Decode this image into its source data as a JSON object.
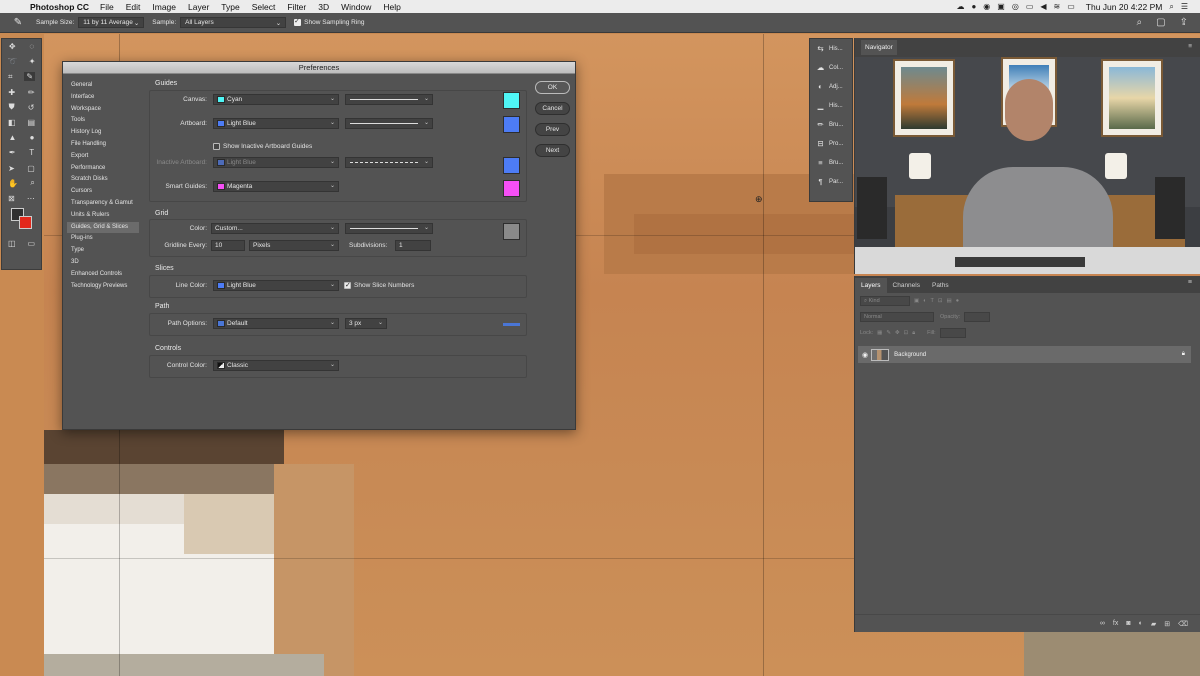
{
  "menubar": {
    "app": "Photoshop CC",
    "items": [
      "File",
      "Edit",
      "Image",
      "Layer",
      "Type",
      "Select",
      "Filter",
      "3D",
      "Window",
      "Help"
    ],
    "clock": "Thu Jun 20  4:22 PM"
  },
  "optionsbar": {
    "sample_size_label": "Sample Size:",
    "sample_size_value": "11 by 11 Average",
    "sample_label": "Sample:",
    "sample_value": "All Layers",
    "show_ring_label": "Show Sampling Ring"
  },
  "dialog": {
    "title": "Preferences",
    "nav": [
      "General",
      "Interface",
      "Workspace",
      "Tools",
      "History Log",
      "File Handling",
      "Export",
      "Performance",
      "Scratch Disks",
      "Cursors",
      "Transparency & Gamut",
      "Units & Rulers",
      "Guides, Grid & Slices",
      "Plug-ins",
      "Type",
      "3D",
      "Enhanced Controls",
      "Technology Previews"
    ],
    "active_nav": 12,
    "buttons": {
      "ok": "OK",
      "cancel": "Cancel",
      "prev": "Prev",
      "next": "Next"
    },
    "guides": {
      "title": "Guides",
      "canvas_label": "Canvas:",
      "canvas_value": "Cyan",
      "canvas_color": "#4ff5f5",
      "artboard_label": "Artboard:",
      "artboard_value": "Light Blue",
      "artboard_color": "#4d7cf5",
      "show_inactive_label": "Show Inactive Artboard Guides",
      "inactive_label": "Inactive Artboard:",
      "inactive_value": "Light Blue",
      "smart_label": "Smart Guides:",
      "smart_value": "Magenta",
      "smart_color": "#f54ff5"
    },
    "grid": {
      "title": "Grid",
      "color_label": "Color:",
      "color_value": "Custom...",
      "color_swatch": "#8a8a8a",
      "every_label": "Gridline Every:",
      "every_value": "10",
      "units_value": "Pixels",
      "subdiv_label": "Subdivisions:",
      "subdiv_value": "1"
    },
    "slices": {
      "title": "Slices",
      "line_label": "Line Color:",
      "line_value": "Light Blue",
      "numbers_label": "Show Slice Numbers"
    },
    "path": {
      "title": "Path",
      "options_label": "Path Options:",
      "options_value": "Default",
      "width_value": "3 px",
      "path_color": "#4a76d6"
    },
    "controls": {
      "title": "Controls",
      "color_label": "Control Color:",
      "color_value": "Classic"
    }
  },
  "strip": [
    "His...",
    "Col...",
    "Adj...",
    "His...",
    "Bru...",
    "Pro...",
    "Bru...",
    "Par..."
  ],
  "navigator": {
    "title": "Navigator"
  },
  "layers": {
    "tabs": [
      "Layers",
      "Channels",
      "Paths"
    ],
    "kind_placeholder": "Kind",
    "blend_mode": "Normal",
    "opacity_label": "Opacity:",
    "lock_label": "Lock:",
    "fill_label": "Fill:",
    "layer_name": "Background"
  }
}
